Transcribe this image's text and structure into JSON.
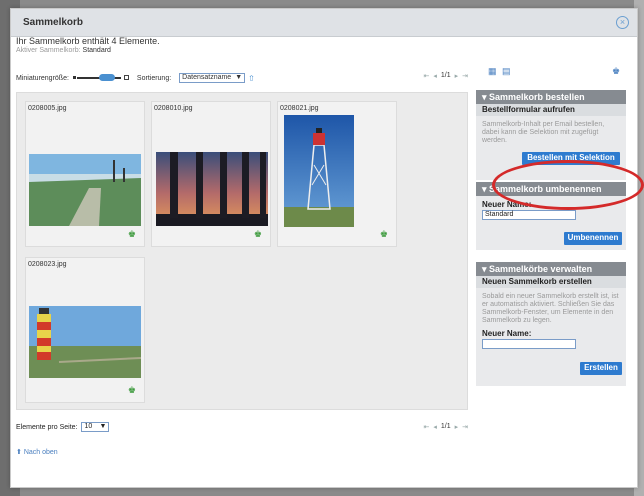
{
  "dialog": {
    "title": "Sammelkorb",
    "count_text": "Ihr Sammelkorb enthält 4 Elemente.",
    "active_label": "Aktiver Sammelkorb:",
    "active_value": "Standard"
  },
  "toolbar": {
    "thumb_size_label": "Miniaturengröße:",
    "sort_label": "Sortierung:",
    "sort_value": "Datensatzname",
    "page": "1/1"
  },
  "items": [
    {
      "filename": "0208005.jpg"
    },
    {
      "filename": "0208010.jpg"
    },
    {
      "filename": "0208021.jpg"
    },
    {
      "filename": "0208023.jpg"
    }
  ],
  "footer": {
    "per_page_label": "Elemente pro Seite:",
    "per_page_value": "10",
    "page": "1/1",
    "top_link": "Nach oben"
  },
  "panels": {
    "order": {
      "header": "Sammelkorb bestellen",
      "sub": "Bestellformular aufrufen",
      "text": "Sammelkorb-Inhalt per Email bestellen, dabei kann die Selektion mit zugefügt werden.",
      "button": "Bestellen mit Selektion"
    },
    "rename": {
      "header": "Sammelkorb umbenennen",
      "label": "Neuer Name:",
      "value": "Standard",
      "button": "Umbenennen"
    },
    "manage": {
      "header": "Sammelkörbe verwalten",
      "sub": "Neuen Sammelkorb erstellen",
      "text": "Sobald ein neuer Sammelkorb erstellt ist, ist er automatisch aktiviert. Schließen Sie das Sammelkorb-Fenster, um Elemente in den Sammelkorb zu legen.",
      "label": "Neuer Name:",
      "value": "",
      "button": "Erstellen"
    }
  },
  "colors": {
    "accent": "#2e7bcf",
    "panel_header": "#868b91",
    "highlight_circle": "#d42a2a"
  }
}
